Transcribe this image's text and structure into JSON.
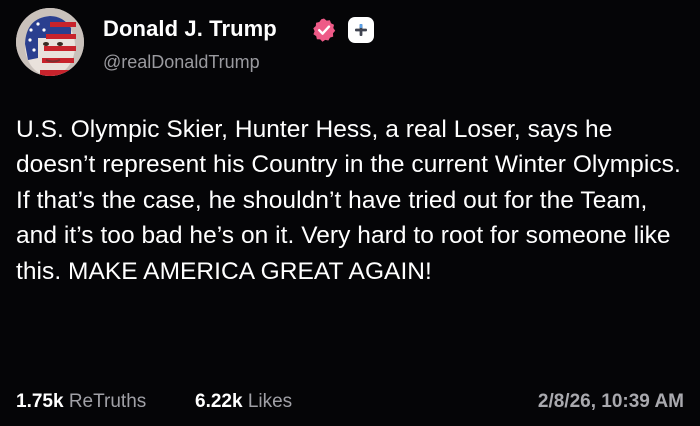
{
  "author": {
    "display_name": "Donald J. Trump",
    "handle": "@realDonaldTrump",
    "verified_badge_icon": "verified-badge-icon",
    "follow_icon": "plus-icon"
  },
  "post": {
    "text": "U.S. Olympic Skier, Hunter Hess, a real Loser, says he doesn’t represent his Country in the current Winter Olympics. If that’s the case, he shouldn’t have tried out for the Team, and it’s too bad he’s on it. Very hard to root for someone like this. MAKE AMERICA GREAT AGAIN!"
  },
  "stats": {
    "retruths_count": "1.75k",
    "retruths_label": "ReTruths",
    "likes_count": "6.22k",
    "likes_label": "Likes",
    "timestamp": "2/8/26, 10:39 AM"
  },
  "colors": {
    "background": "#050507",
    "text": "#ffffff",
    "muted": "#9a9a9f",
    "verified_badge": "#ee5a87"
  }
}
